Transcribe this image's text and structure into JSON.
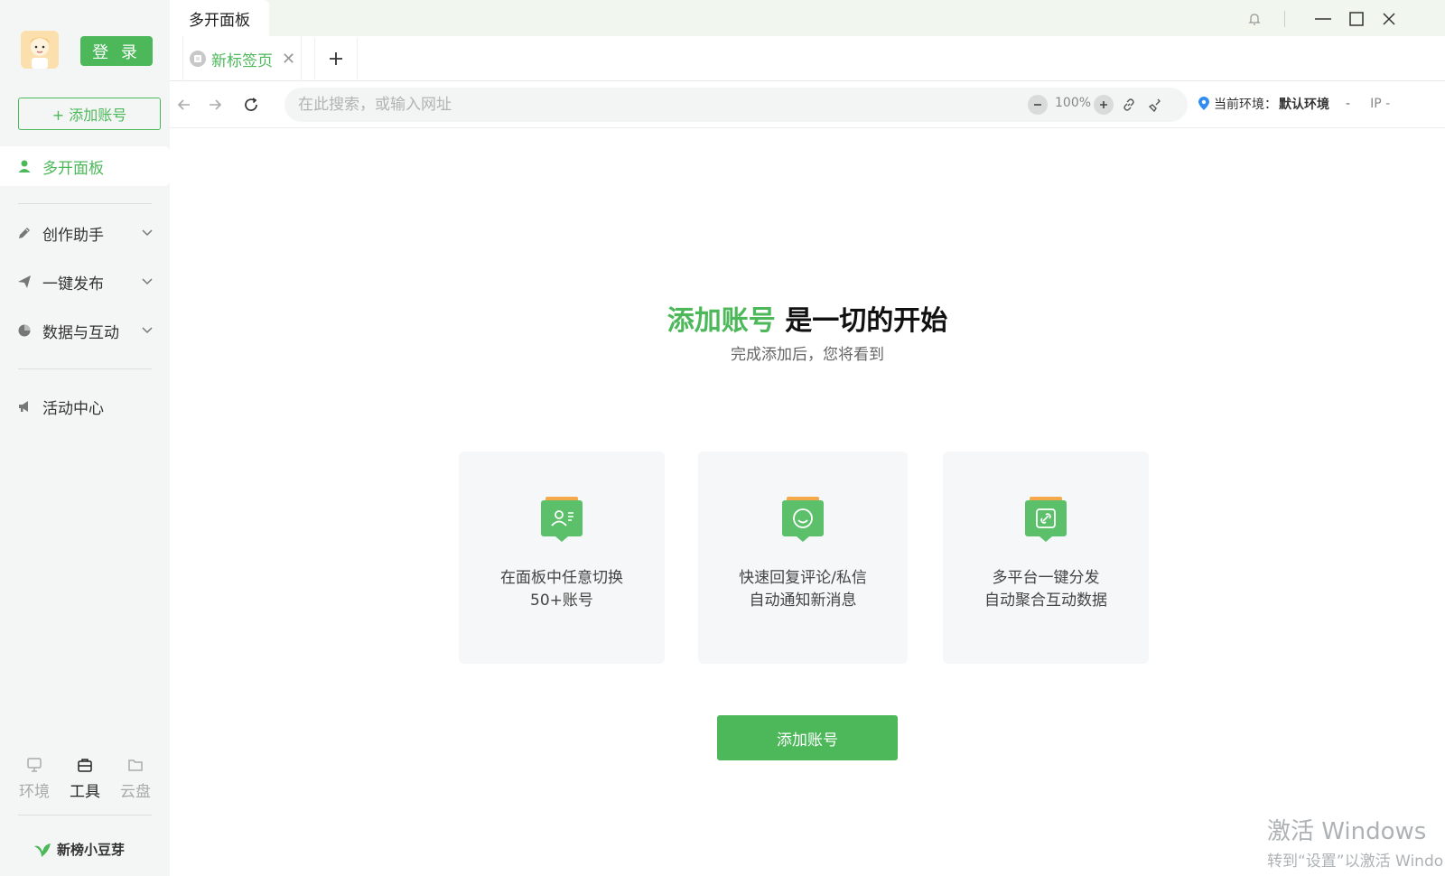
{
  "app": {
    "tab_title": "多开面板"
  },
  "sidebar": {
    "login_label": "登 录",
    "add_account_label": "+ 添加账号",
    "items": [
      {
        "label": "多开面板",
        "icon": "user-icon"
      },
      {
        "label": "创作助手",
        "icon": "pen-icon"
      },
      {
        "label": "一键发布",
        "icon": "send-icon"
      },
      {
        "label": "数据与互动",
        "icon": "pie-chart-icon"
      },
      {
        "label": "活动中心",
        "icon": "megaphone-icon"
      }
    ],
    "tools": [
      {
        "label": "环境",
        "icon": "monitor-icon"
      },
      {
        "label": "工具",
        "icon": "toolbox-icon"
      },
      {
        "label": "云盘",
        "icon": "folder-icon"
      }
    ],
    "brand": "新榜小豆芽"
  },
  "browser": {
    "tab_label": "新标签页",
    "address_placeholder": "在此搜索，或输入网址",
    "zoom": "100%",
    "env_label": "当前环境：",
    "env_value": "默认环境",
    "env_sep": "-",
    "ip_label": "IP -"
  },
  "content": {
    "title_highlight": "添加账号",
    "title_rest": " 是一切的开始",
    "subtitle": "完成添加后，您将看到",
    "cards": [
      {
        "line1": "在面板中任意切换",
        "line2": "50+账号"
      },
      {
        "line1": "快速回复评论/私信",
        "line2": "自动通知新消息"
      },
      {
        "line1": "多平台一键分发",
        "line2": "自动聚合互动数据"
      }
    ],
    "cta_label": "添加账号"
  },
  "watermark": {
    "line1": "激活 Windows",
    "line2": "转到“设置”以激活 Windo"
  },
  "colors": {
    "accent": "#4cb85a",
    "highlight": "#f6b24c"
  }
}
